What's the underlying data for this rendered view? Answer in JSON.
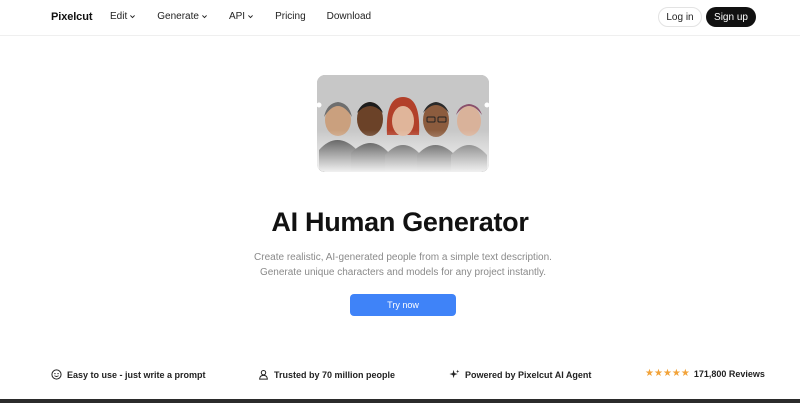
{
  "nav": {
    "logo": "Pixelcut",
    "items": [
      {
        "label": "Edit",
        "dropdown": true
      },
      {
        "label": "Generate",
        "dropdown": true
      },
      {
        "label": "API",
        "dropdown": true
      },
      {
        "label": "Pricing",
        "dropdown": false
      },
      {
        "label": "Download",
        "dropdown": false
      }
    ],
    "login": "Log in",
    "signup": "Sign up"
  },
  "hero": {
    "image_icon": "ai-human-portraits-image",
    "title": "AI Human Generator",
    "subtitle_line1": "Create realistic, AI-generated people from a simple text description.",
    "subtitle_line2": "Generate unique characters and models for any project instantly.",
    "cta": "Try now"
  },
  "features": [
    {
      "icon": "smiley-icon",
      "label": "Easy to use - just write a prompt"
    },
    {
      "icon": "user-icon",
      "label": "Trusted by 70 million people"
    },
    {
      "icon": "sparkle-icon",
      "label": "Powered by Pixelcut AI Agent"
    }
  ],
  "reviews": {
    "stars": 5,
    "label": "171,800 Reviews"
  },
  "colors": {
    "accent": "#3f83f8",
    "star": "#f2a33a",
    "text": "#111111",
    "muted": "#8a8a8a"
  }
}
